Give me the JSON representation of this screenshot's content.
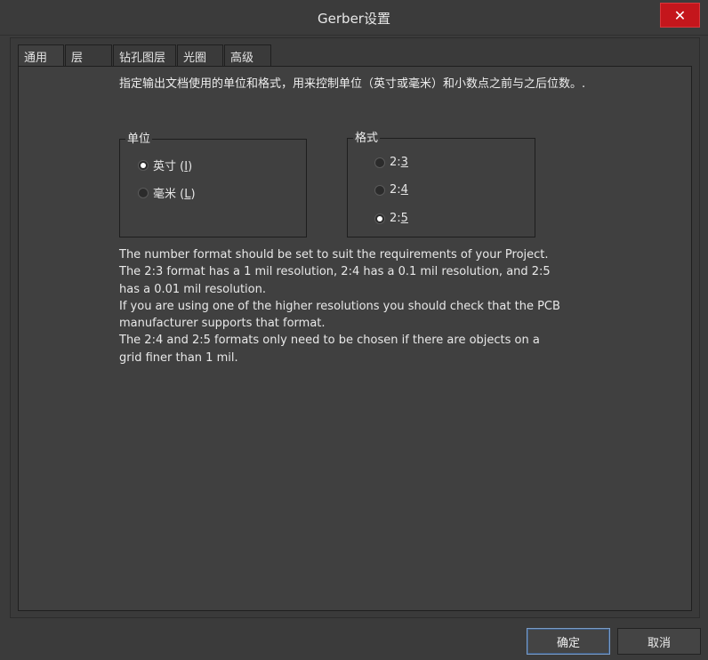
{
  "window": {
    "title": "Gerber设置",
    "close_label": "✕"
  },
  "tabs": [
    {
      "label": "通用"
    },
    {
      "label": "层"
    },
    {
      "label": "钻孔图层"
    },
    {
      "label": "光圈"
    },
    {
      "label": "高级"
    }
  ],
  "intro": "指定输出文档使用的单位和格式，用来控制单位（英寸或毫米）和小数点之前与之后位数。.",
  "units_group": {
    "legend": "单位",
    "options": [
      {
        "label": "英寸 (",
        "key": "I",
        "suffix": ")",
        "checked": true
      },
      {
        "label": "毫米 (",
        "key": "L",
        "suffix": ")",
        "checked": false
      }
    ]
  },
  "format_group": {
    "legend": "格式",
    "options": [
      {
        "prefix": "2:",
        "key": "3",
        "checked": false
      },
      {
        "prefix": "2:",
        "key": "4",
        "checked": false
      },
      {
        "prefix": "2:",
        "key": "5",
        "checked": true
      }
    ]
  },
  "description": [
    "The number format should be set to suit the requirements of your Project.",
    "The 2:3 format has a 1 mil resolution, 2:4 has a 0.1 mil resolution, and 2:5 has a 0.01 mil resolution.",
    "If you are using one of the higher resolutions you should check that the PCB manufacturer supports that format.",
    "The 2:4 and 2:5 formats only need to be chosen if there are objects on a grid finer than 1 mil."
  ],
  "buttons": {
    "ok": "确定",
    "cancel": "取消"
  },
  "colors": {
    "close_bg": "#c4161c",
    "panel_bg": "#404040",
    "window_bg": "#3b3b3b",
    "ok_border": "#7a9cc6"
  }
}
